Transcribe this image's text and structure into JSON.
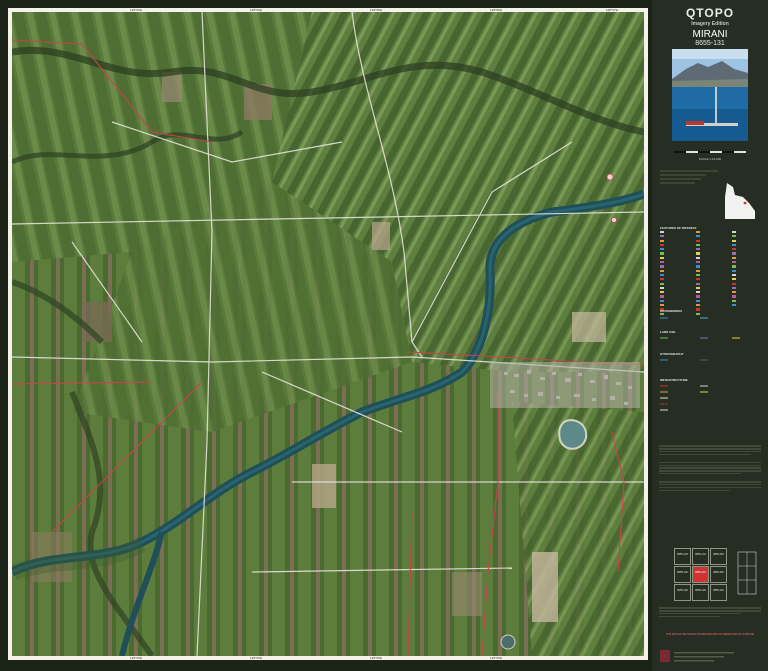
{
  "panel": {
    "brand": "QTOPO",
    "edition": "Imagery Edition",
    "sheet_name": "MIRANI",
    "sheet_number": "8655-131",
    "scale_text": "SCALE 1:15,000"
  },
  "colors": {
    "panel_bg": "#262d23",
    "map_border": "#f4f2ea",
    "river": "#1f4f58",
    "boundary": "#c9434b",
    "road": "#e4e4da",
    "town": "#b5b0a8"
  },
  "legend": {
    "features_title": "FEATURES OF INTEREST",
    "waterbodies_title": "WATERBODIES",
    "land_use_title": "LAND USE",
    "hydrography_title": "HYDROGRAPHY",
    "infrastructure_title": "INFRASTRUCTURE"
  },
  "grid_ticks": [
    "148°53'E",
    "148°54'E",
    "148°55'E",
    "148°56'E",
    "148°57'E"
  ],
  "index_sheets": [
    {
      "num": "8655-133"
    },
    {
      "num": "8655-134"
    },
    {
      "num": "8655-243"
    },
    {
      "num": "8655-132"
    },
    {
      "num": "8655-131"
    },
    {
      "num": "8655-242"
    },
    {
      "num": "8655-130"
    },
    {
      "num": "8655-129"
    },
    {
      "num": "8655-241"
    }
  ],
  "notes": {
    "disclaimer_heading": "THIS MAP MAY BE PRINTED OR REPRODUCED OR VIEWED FOR ANY PURPOSE"
  }
}
